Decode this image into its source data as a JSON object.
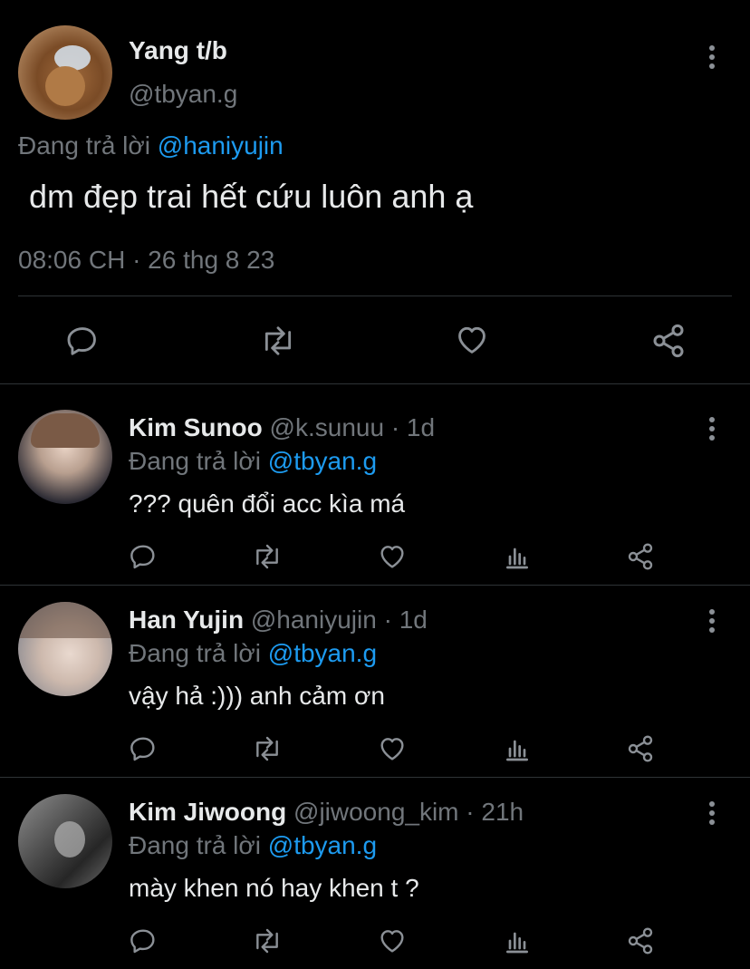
{
  "main_tweet": {
    "display_name": "Yang t/b",
    "handle": "@tbyan.g",
    "reply_prefix": "Đang trả lời",
    "reply_to": "@haniyujin",
    "text": "dm đẹp trai hết cứu luôn anh ạ",
    "timestamp": "08:06 CH · 26 thg 8 23",
    "actions": [
      "reply-icon",
      "retweet-icon",
      "like-icon",
      "share-icon"
    ]
  },
  "replies": [
    {
      "display_name": "Kim Sunoo",
      "handle": "@k.sunuu",
      "time": "· 1d",
      "reply_prefix": "Đang trả lời",
      "reply_to": "@tbyan.g",
      "text": "??? quên đổi acc kìa má"
    },
    {
      "display_name": "Han Yujin",
      "handle": "@haniyujin",
      "time": "· 1d",
      "reply_prefix": "Đang trả lời",
      "reply_to": "@tbyan.g",
      "text": "vậy hả :))) anh cảm ơn"
    },
    {
      "display_name": "Kim Jiwoong",
      "handle": "@jiwoong_kim",
      "time": "· 21h",
      "reply_prefix": "Đang trả lời",
      "reply_to": "@tbyan.g",
      "text": "mày khen nó hay khen t ?"
    }
  ],
  "colors": {
    "background": "#000000",
    "text": "#e7e9ea",
    "muted": "#71767b",
    "link": "#1d9bf0",
    "divider": "#2f3336"
  }
}
